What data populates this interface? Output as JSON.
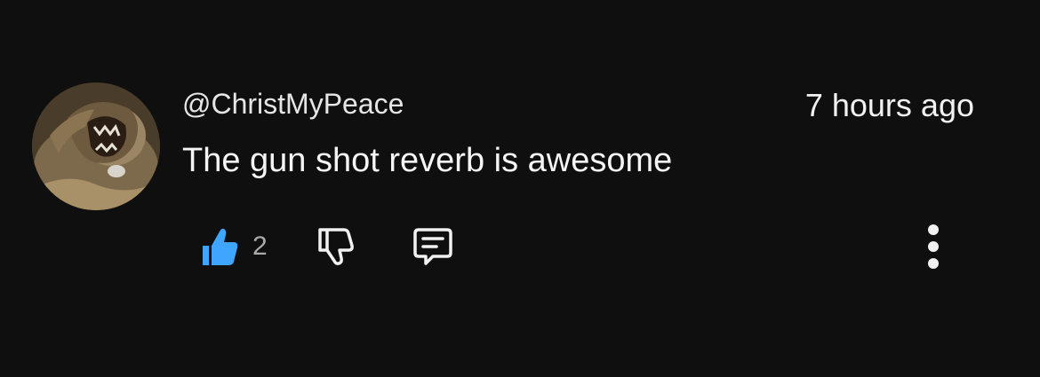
{
  "comment": {
    "author": "@ChristMyPeace",
    "timestamp": "7 hours ago",
    "text": "The gun shot reverb is awesome",
    "like_count": "2",
    "liked": true
  },
  "icons": {
    "like": "thumbs-up-icon",
    "dislike": "thumbs-down-icon",
    "reply": "comment-icon",
    "more": "more-vertical-icon"
  },
  "colors": {
    "background": "#0f0f0f",
    "liked_accent": "#3ea6ff",
    "text_primary": "#f1f1f1",
    "text_secondary": "#aaaaaa"
  }
}
